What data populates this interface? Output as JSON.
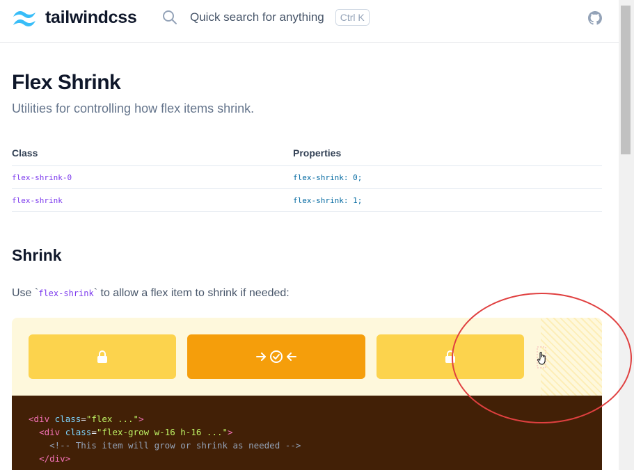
{
  "header": {
    "logo_text": "tailwindcss",
    "search_placeholder": "Quick search for anything",
    "shortcut": "Ctrl K"
  },
  "page": {
    "title": "Flex Shrink",
    "subtitle": "Utilities for controlling how flex items shrink."
  },
  "table": {
    "headers": [
      "Class",
      "Properties"
    ],
    "rows": [
      {
        "class": "flex-shrink-0",
        "properties": "flex-shrink: 0;"
      },
      {
        "class": "flex-shrink",
        "properties": "flex-shrink: 1;"
      }
    ]
  },
  "section": {
    "title": "Shrink",
    "lead_before": "Use `",
    "lead_code": "flex-shrink",
    "lead_after": "` to allow a flex item to shrink if needed:"
  },
  "demo": {
    "colors": {
      "light_box": "#fcd34d",
      "dark_box": "#f59e0b",
      "background": "#fef8dc"
    },
    "icons": [
      "lock-icon",
      "shrink-arrows-icon",
      "lock-icon"
    ]
  },
  "code": {
    "line1_tag": "<div",
    "line1_attr": "class",
    "line1_str": "\"flex ...\"",
    "line1_end": ">",
    "line2_tag": "<div",
    "line2_attr": "class",
    "line2_str": "\"flex-grow w-16 h-16 ...\"",
    "line2_end": ">",
    "line3_comment": "<!-- This item will grow or shrink as needed -->",
    "line4_tag": "</div>"
  },
  "annotation": {
    "circle_color": "#e04040"
  }
}
